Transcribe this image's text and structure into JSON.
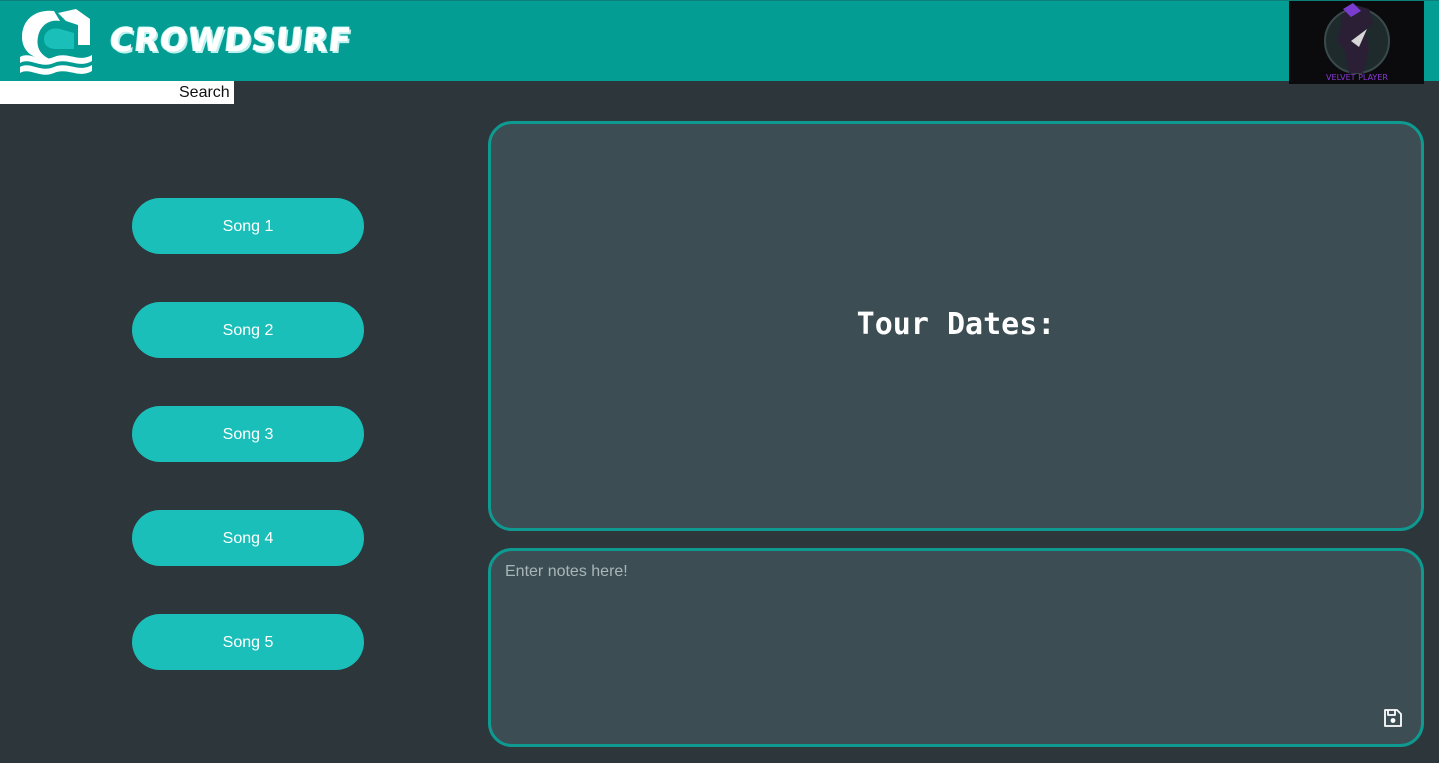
{
  "header": {
    "brand_name": "CROWDSURF",
    "logo_icon": "wave-house-icon",
    "avatar_caption": "VELVET PLAYER",
    "colors": {
      "bar": "#039d94",
      "accent": "#1bbfba"
    }
  },
  "search": {
    "value": "",
    "placeholder": "",
    "button_label": "Search"
  },
  "songs": [
    {
      "label": "Song 1"
    },
    {
      "label": "Song 2"
    },
    {
      "label": "Song 3"
    },
    {
      "label": "Song 4"
    },
    {
      "label": "Song 5"
    }
  ],
  "tour": {
    "title": "Tour Dates:"
  },
  "notes": {
    "value": "",
    "placeholder": "Enter notes here!",
    "save_icon": "floppy-disk-icon"
  }
}
